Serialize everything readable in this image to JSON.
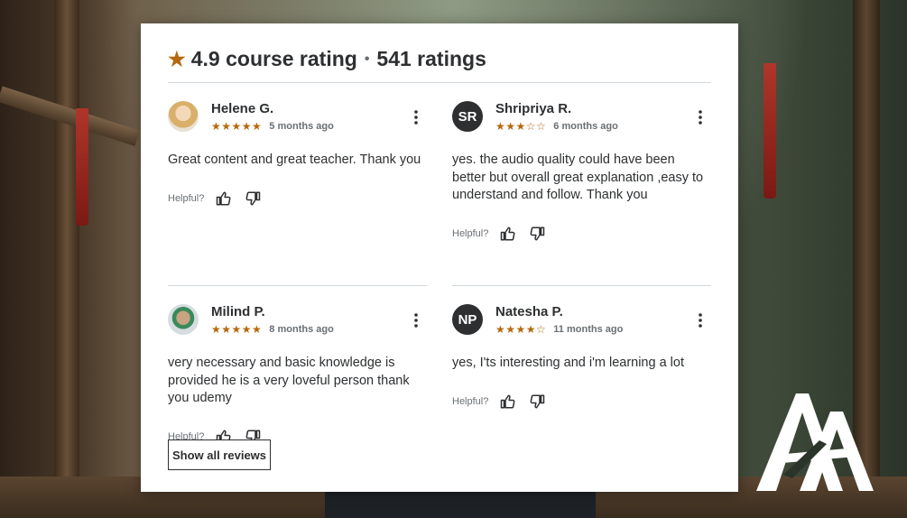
{
  "header": {
    "rating": "4.9 course rating",
    "separator": "•",
    "count": "541 ratings"
  },
  "reviews": [
    {
      "name": "Helene G.",
      "initials": "",
      "stars": "★★★★★",
      "stars_empty": "",
      "rating": 5,
      "time": "5 months ago",
      "text": "Great content and great teacher. Thank you",
      "helpful_label": "Helpful?"
    },
    {
      "name": "Shripriya R.",
      "initials": "SR",
      "stars": "★★★",
      "stars_empty": "☆☆",
      "rating": 3,
      "time": "6 months ago",
      "text": "yes. the audio quality could have been better but overall great explanation ,easy to understand and follow. Thank you",
      "helpful_label": "Helpful?"
    },
    {
      "name": "Milind P.",
      "initials": "",
      "stars": "★★★★★",
      "stars_empty": "",
      "rating": 5,
      "time": "8 months ago",
      "text": "very necessary and basic knowledge is provided he is a very loveful person thank you udemy",
      "helpful_label": "Helpful?"
    },
    {
      "name": "Natesha P.",
      "initials": "NP",
      "stars": "★★★★",
      "stars_empty": "☆",
      "rating": 4,
      "time": "11 months ago",
      "text": "yes, I'ts interesting and i'm learning a lot",
      "helpful_label": "Helpful?"
    }
  ],
  "show_all_label": "Show all reviews",
  "colors": {
    "star": "#b4690e",
    "text": "#2d2f31",
    "muted": "#6a6f73",
    "divider": "#d1d7dc",
    "avatar_bg": "#2d2f31"
  },
  "icons": [
    "star-icon",
    "more-vertical-icon",
    "thumbs-up-icon",
    "thumbs-down-icon"
  ]
}
